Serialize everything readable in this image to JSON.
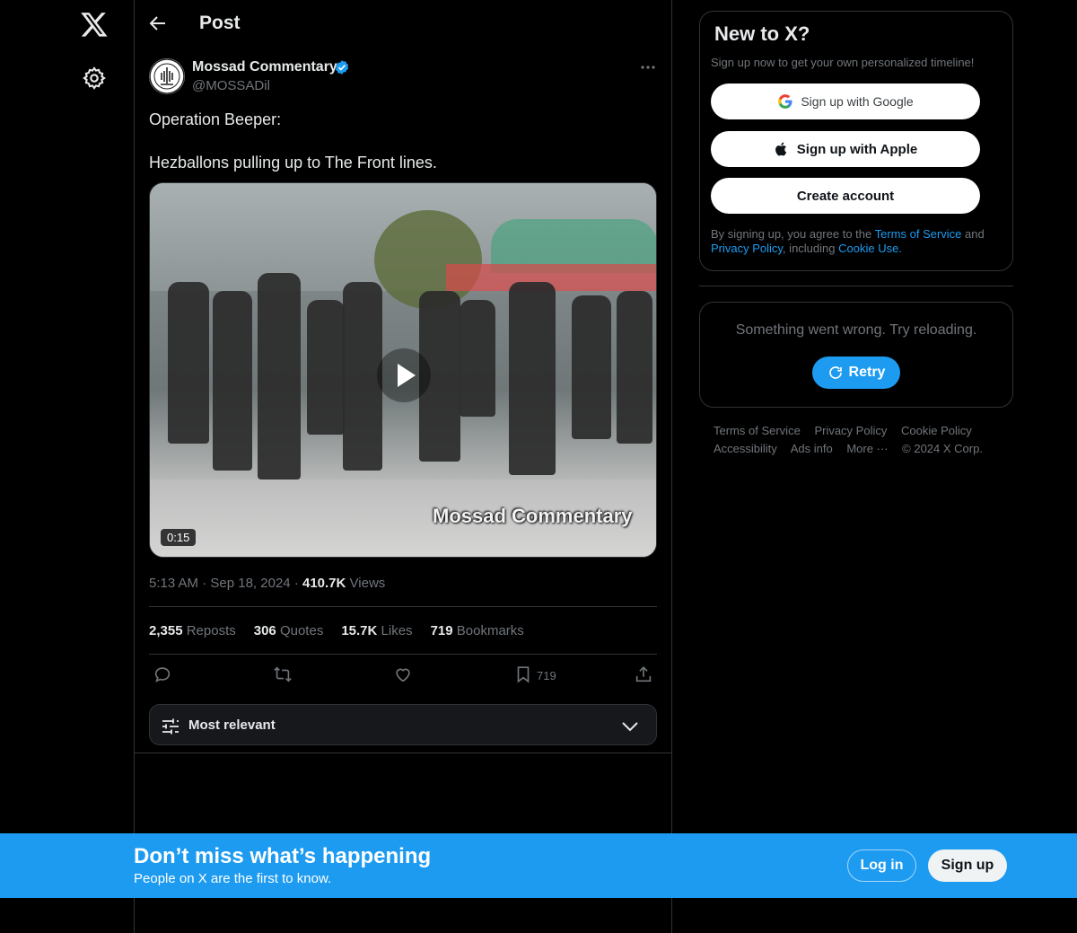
{
  "nav": {
    "logo_icon": "x-logo-icon",
    "settings_icon": "gear-icon"
  },
  "header": {
    "title": "Post"
  },
  "post": {
    "author_name": "Mossad Commentary",
    "author_handle": "@MOSSADil",
    "text_line1": "Operation Beeper:",
    "text_line2": "Hezballons pulling up to The Front lines.",
    "video_duration": "0:15",
    "video_watermark": "Mossad Commentary",
    "time": "5:13 AM",
    "date": "Sep 18, 2024",
    "views_count": "410.7K",
    "views_label": "Views",
    "stats": {
      "reposts_count": "2,355",
      "reposts_label": "Reposts",
      "quotes_count": "306",
      "quotes_label": "Quotes",
      "likes_count": "15.7K",
      "likes_label": "Likes",
      "bookmarks_count": "719",
      "bookmarks_label": "Bookmarks"
    },
    "bookmark_action_count": "719",
    "sort_label": "Most relevant"
  },
  "signup": {
    "title": "New to X?",
    "subtitle": "Sign up now to get your own personalized timeline!",
    "google_label": "Sign up with Google",
    "apple_label": "Sign up with Apple",
    "create_label": "Create account",
    "legal_prefix": "By signing up, you agree to the ",
    "terms_link": "Terms of Service",
    "legal_and": " and",
    "privacy_link": "Privacy Policy",
    "legal_including": ", including ",
    "cookie_link": "Cookie Use."
  },
  "error": {
    "message": "Something went wrong. Try reloading.",
    "retry_label": "Retry"
  },
  "footer": {
    "terms": "Terms of Service",
    "privacy": "Privacy Policy",
    "cookie": "Cookie Policy",
    "accessibility": "Accessibility",
    "ads": "Ads info",
    "more": "More ···",
    "copyright": "© 2024 X Corp."
  },
  "banner": {
    "title": "Don’t miss what’s happening",
    "subtitle": "People on X are the first to know.",
    "login_label": "Log in",
    "signup_label": "Sign up"
  },
  "colors": {
    "accent": "#1d9bf0",
    "background": "#000000",
    "muted": "#71767b",
    "border": "#2f3336"
  }
}
